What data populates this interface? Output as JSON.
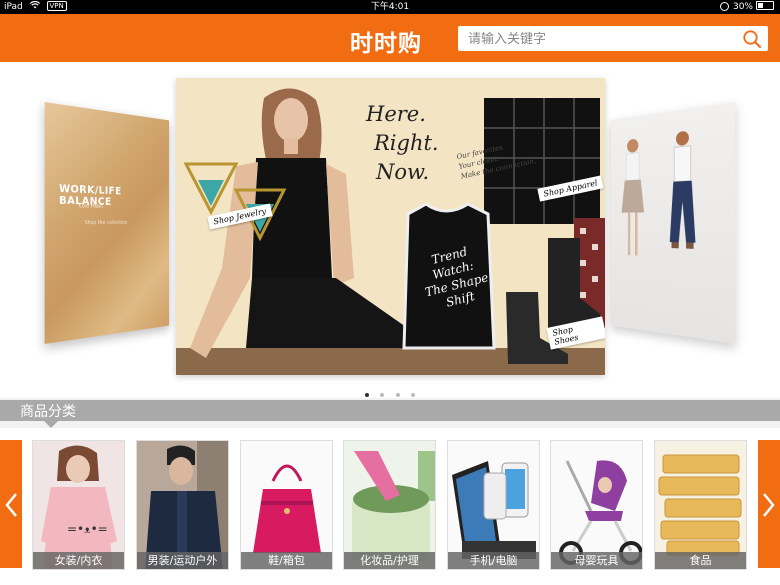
{
  "status_bar": {
    "device": "iPad",
    "network": "VPN",
    "time": "下午4:01",
    "battery": "30%"
  },
  "header": {
    "title": "时时购",
    "search": {
      "placeholder": "请输入关键字",
      "value": ""
    }
  },
  "carousel": {
    "left_banner": {
      "title": "WORK/LIFE BALANCE",
      "line1": "Cole Haan",
      "line2": "Shop the collection"
    },
    "main_banner": {
      "headline_lines": [
        "Here.",
        "Right.",
        "Now."
      ],
      "subtext_lines": [
        "Our favorites.",
        "Your closet.",
        "Make the connection."
      ],
      "tags": {
        "jewelry": "Shop Jewelry",
        "apparel": "Shop Apparel",
        "shoes": "Shop Shoes"
      },
      "trend_lines": [
        "Trend",
        "Watch:",
        "The Shape",
        "Shift"
      ]
    },
    "page_count": 4,
    "active_index": 0
  },
  "categories": {
    "section_title": "商品分类",
    "items": [
      {
        "label": "女装/内衣",
        "icon": "womens-clothing-icon"
      },
      {
        "label": "男装/运动户外",
        "icon": "mens-clothing-icon"
      },
      {
        "label": "鞋/箱包",
        "icon": "handbag-icon"
      },
      {
        "label": "化妆品/护理",
        "icon": "cosmetics-icon"
      },
      {
        "label": "手机/电脑",
        "icon": "phone-icon"
      },
      {
        "label": "母婴玩具",
        "icon": "stroller-icon"
      },
      {
        "label": "食品",
        "icon": "food-icon"
      }
    ]
  },
  "colors": {
    "brand_orange": "#f26c12",
    "category_bar": "#a9a9a9"
  }
}
